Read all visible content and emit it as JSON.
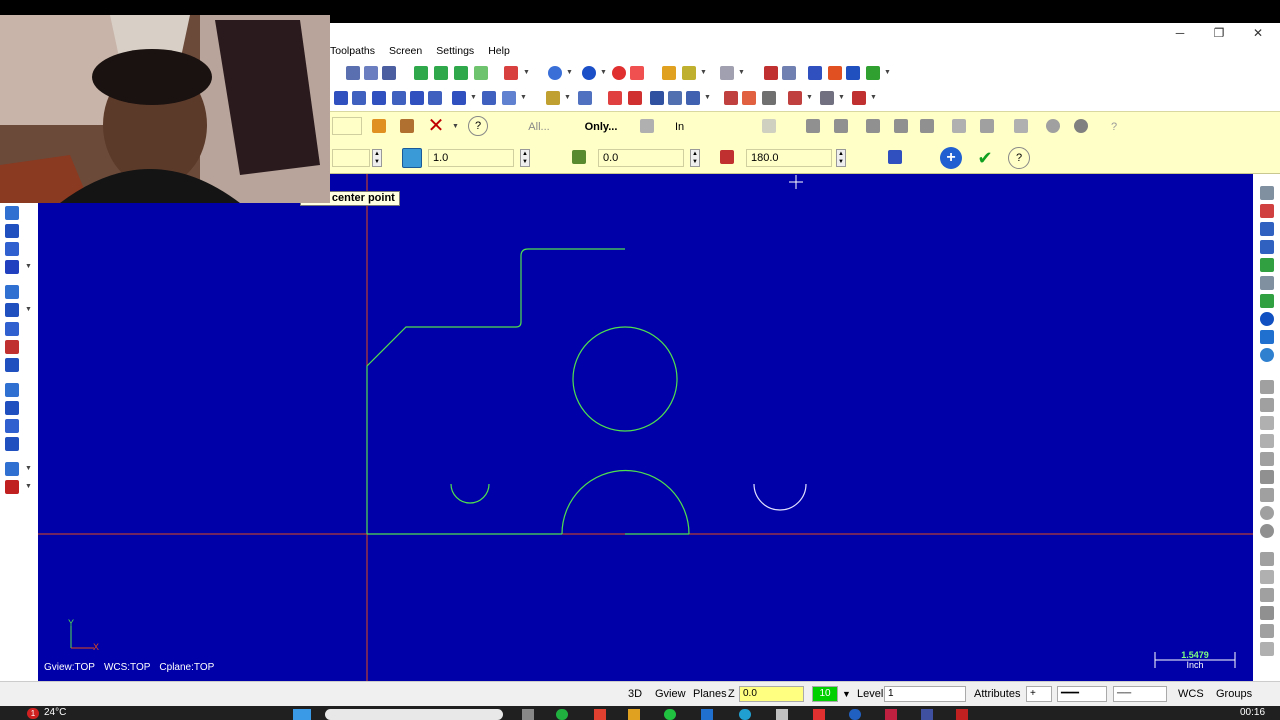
{
  "window": {
    "minimize": "─",
    "maximize": "❐",
    "close": "✕"
  },
  "menu": [
    "Toolpaths",
    "Screen",
    "Settings",
    "Help"
  ],
  "ribbon": {
    "all_label": "All...",
    "only_label": "Only...",
    "in_label": "In",
    "radius_value": "1.0",
    "start_angle_value": "0.0",
    "sweep_angle_value": "180.0"
  },
  "tooltip": "r the center point",
  "viewport": {
    "gview": "Gview:TOP",
    "wcs": "WCS:TOP",
    "cplane": "Cplane:TOP",
    "axis_y": "Y",
    "axis_x": "X",
    "scale_value": "1.5479",
    "scale_unit": "Inch"
  },
  "statusbar": {
    "mode_3d": "3D",
    "gview": "Gview",
    "planes": "Planes",
    "z_label": "Z",
    "z_value": "0.0",
    "color_value": "10",
    "level_label": "Level",
    "level_value": "1",
    "attributes": "Attributes",
    "wcs": "WCS",
    "groups": "Groups"
  },
  "taskbar": {
    "weather": "24°C",
    "alert_badge": "1",
    "time": "00:16"
  },
  "colors": {
    "viewport_bg": "#0000a8",
    "geometry": "#4fe04f",
    "axis": "#e04a1a",
    "ribbon_bg": "#ffffc8"
  }
}
